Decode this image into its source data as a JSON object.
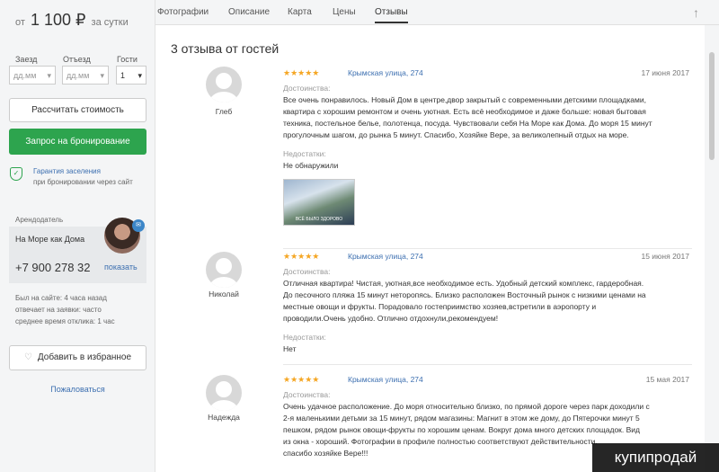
{
  "sidebar": {
    "price_prefix": "от",
    "price": "1 100 ₽",
    "price_suffix": "за сутки",
    "checkin_label": "Заезд",
    "checkout_label": "Отъезд",
    "guests_label": "Гости",
    "checkin_value": "дд.мм",
    "checkout_value": "дд.мм",
    "guests_value": "1",
    "calc_button": "Рассчитать стоимость",
    "book_button": "Запрос на бронирование",
    "guarantee_title": "Гарантия заселения",
    "guarantee_sub": "при бронировании через сайт",
    "landlord_label": "Арендодатель",
    "landlord_name": "На Море как Дома",
    "phone": "+7 900 278 32",
    "show": "показать",
    "last_seen": "Был на сайте: 4 часа назад",
    "replies": "отвечает на заявки: часто",
    "response_time": "среднее время отклика: 1 час",
    "fav_button": "Добавить в избранное",
    "complain": "Пожаловаться"
  },
  "tabs": [
    "Фотографии",
    "Описание",
    "Карта",
    "Цены",
    "Отзывы"
  ],
  "heading": "3 отзыва от гостей",
  "pros_label": "Достоинства:",
  "cons_label": "Недостатки:",
  "reviews": [
    {
      "name": "Глеб",
      "stars": "★★★★★",
      "address": "Крымская улица, 274",
      "date": "17 июня 2017",
      "pros_lines": [
        "Все очень понравилось. Новый Дом в центре,двор закрытый с современными детскими площадками,",
        "квартира с хорошим ремонтом и очень уютная. Есть всё необходимое и даже больше: новая бытовая",
        "техника, постельное белье, полотенца, посуда. Чувствовали себя На Море как Дома. До моря 15 минут",
        "прогулочным шагом, до рынка 5 минут. Спасибо, Хозяйке Вере, за великолепный отдых на море."
      ],
      "cons": "Не обнаружили",
      "photo_caption": "ВСЁ БЫЛО ЗДОРОВО"
    },
    {
      "name": "Николай",
      "stars": "★★★★★",
      "address": "Крымская улица, 274",
      "date": "15 июня 2017",
      "pros_lines": [
        "Отличная квартира! Чистая, уютная,все необходимое есть. Удобный детский комплекс, гардеробная.",
        "До песочного пляжа 15 минут неторопясь. Близко расположен Восточный рынок с низкими ценами на",
        "местные овощи и фрукты. Порадовало гостеприимство хозяев,встретили в аэропорту и",
        "проводили.Очень удобно. Отлично отдохнули,рекомендуем!"
      ],
      "cons": "Нет"
    },
    {
      "name": "Надежда",
      "stars": "★★★★★",
      "address": "Крымская улица, 274",
      "date": "15 мая 2017",
      "pros_lines": [
        "Очень удачное расположение. До моря относительно близко, по прямой дороге через парк доходили с",
        "2-я маленькими детьми за 15 минут, рядом магазины: Магнит в этом же дому, до Пятерочки минут 5",
        "пешком, рядом рынок овощи-фрукты по хорошим ценам. Вокруг дома много детских площадок. Вид",
        "из окна - хороший. Фотографии в профиле полностью соответствуют действительности.",
        "спасибо хозяйке Вере!!!"
      ]
    }
  ],
  "watermark": "купипродай"
}
